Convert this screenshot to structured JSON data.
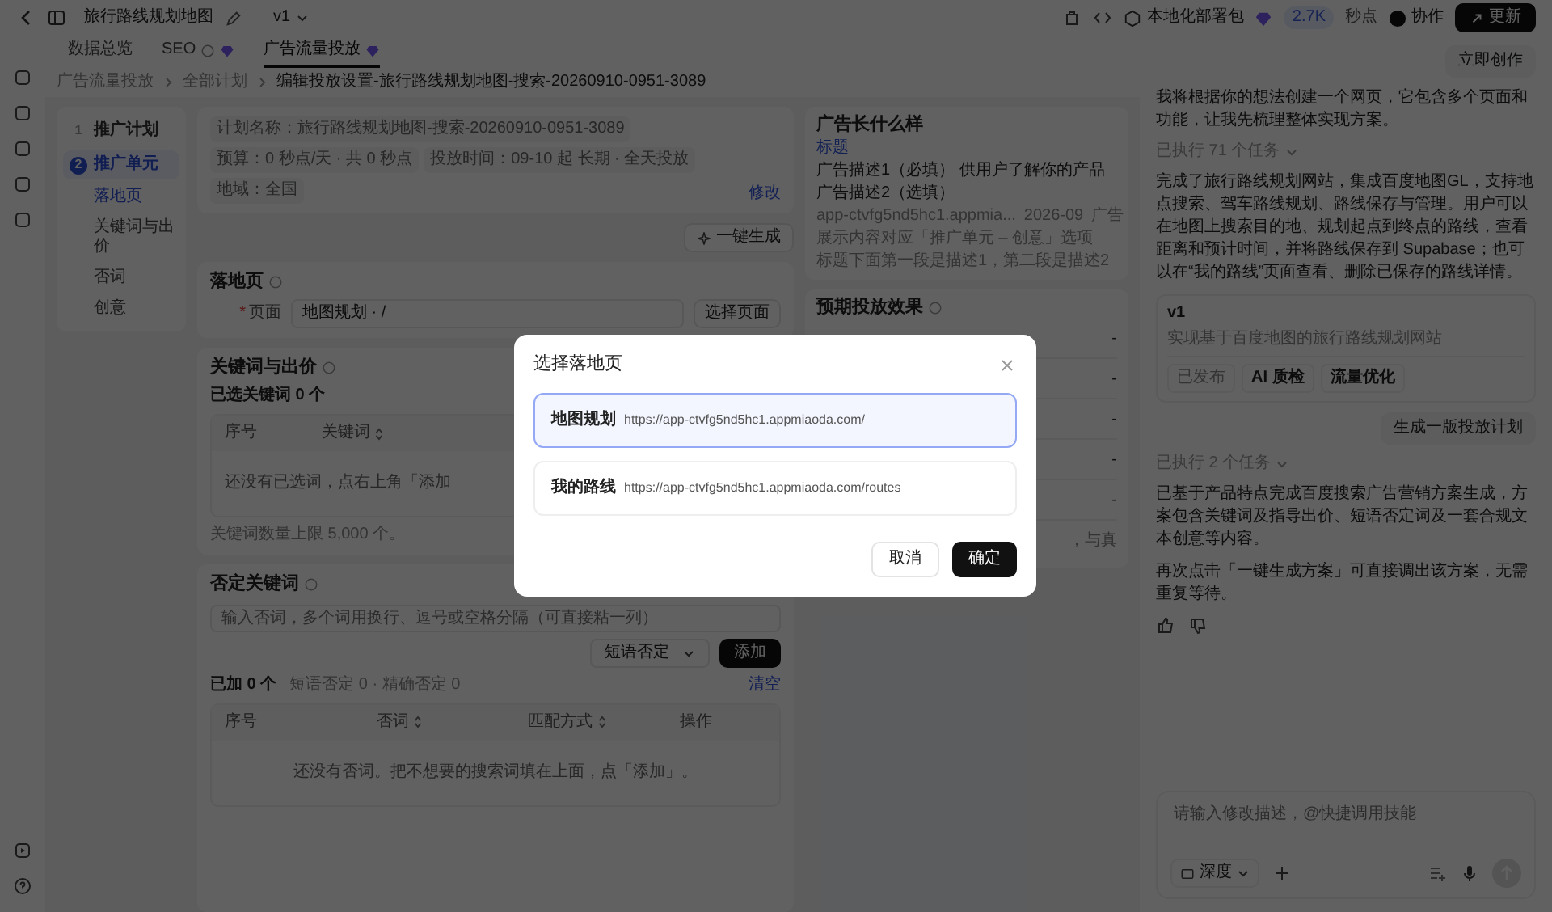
{
  "top_bar": {
    "title": "旅行路线规划地图",
    "version": "v1",
    "deploy": "本地化部署包",
    "points_value": "2.7K",
    "points_unit": "秒点",
    "collab": "协作",
    "update": "更新"
  },
  "tabs": [
    {
      "label": "数据总览",
      "selected": false,
      "help": false,
      "premium": false
    },
    {
      "label": "SEO",
      "selected": false,
      "help": true,
      "premium": true
    },
    {
      "label": "广告流量投放",
      "selected": true,
      "help": false,
      "premium": true
    }
  ],
  "breadcrumb": [
    "广告流量投放",
    "全部计划",
    "编辑投放设置-旅行路线规划地图-搜索-20260910-0951-3089"
  ],
  "steps": [
    {
      "number": "1",
      "label": "推广计划",
      "selected": false
    },
    {
      "number": "2",
      "label": "推广单元",
      "selected": true,
      "children": [
        {
          "label": "落地页",
          "selected": true
        },
        {
          "label": "关键词与出价",
          "selected": false
        },
        {
          "label": "否词",
          "selected": false
        },
        {
          "label": "创意",
          "selected": false
        }
      ]
    }
  ],
  "plan_summary": {
    "chips": [
      {
        "label": "计划名称：",
        "value": "旅行路线规划地图-搜索-20260910-0951-3089"
      },
      {
        "label": "预算：",
        "value": "0 秒点/天 · 共 0 秒点"
      },
      {
        "label": "投放时间：",
        "value": "09-10 起 长期 · 全天投放"
      },
      {
        "label": "地域：",
        "value": "全国"
      }
    ],
    "edit": "修改"
  },
  "generate_button": "一键生成",
  "landing_page": {
    "title": "落地页",
    "required_mark": "*",
    "field_label": "页面",
    "value": "地图规划 · /",
    "button": "选择页面"
  },
  "keywords": {
    "title": "关键词与出价",
    "selected_count": "已选关键词 0 个",
    "columns": [
      {
        "label": "序号",
        "sortable": false
      },
      {
        "label": "关键词",
        "sortable": true
      }
    ],
    "empty": "还没有已选词，点右上角「添加",
    "limit_note": "关键词数量上限 5,000 个。"
  },
  "negative_keywords": {
    "title": "否定关键词",
    "placeholder": "输入否词，多个词用换行、逗号或空格分隔（可直接粘一列）",
    "match_type": "短语否定",
    "add": "添加",
    "added": "已加 0 个",
    "stats": "短语否定 0 · 精确否定 0",
    "clear": "清空",
    "columns": [
      {
        "label": "序号",
        "sortable": false
      },
      {
        "label": "否词",
        "sortable": true
      },
      {
        "label": "匹配方式",
        "sortable": true
      },
      {
        "label": "操作",
        "sortable": false
      }
    ],
    "empty": "还没有否词。把不想要的搜索词填在上面，点「添加」。"
  },
  "ad_preview": {
    "title": "广告长什么样",
    "headline": "标题",
    "descriptions": [
      "广告描述1（必填） 供用户了解你的产品",
      "广告描述2（选填）"
    ],
    "url": "app-ctvfg5nd5hc1.appmia...",
    "date": "2026-09",
    "tag": "广告",
    "notes": [
      "展示内容对应「推广单元 – 创意」选项",
      "标题下面第一段是描述1，第二段是描述2"
    ]
  },
  "forecast": {
    "title": "预期投放效果",
    "rows": [
      "-",
      "-",
      "-",
      "-",
      "-"
    ],
    "note": "，与真"
  },
  "chat": {
    "create_button": "立即创作",
    "intro": "我将根据你的想法创建一个网页，它包含多个页面和功能，让我先梳理整体实现方案。",
    "tasks_1": "已执行 71 个任务",
    "summary": "完成了旅行路线规划网站，集成百度地图GL，支持地点搜索、驾车路线规划、路线保存与管理。用户可以在地图上搜索目的地、规划起点到终点的路线，查看距离和预计时间，并将路线保存到 Supabase；也可以在“我的路线”页面查看、删除已保存的路线详情。",
    "version_card": {
      "name": "v1",
      "description": "实现基于百度地图的旅行路线规划网站",
      "tags": [
        {
          "label": "已发布",
          "disabled": true
        },
        {
          "label": "AI 质检",
          "disabled": false
        },
        {
          "label": "流量优化",
          "disabled": false
        }
      ]
    },
    "user_message": "生成一版投放计划",
    "tasks_2": "已执行 2 个任务",
    "replies": [
      "已基于产品特点完成百度搜索广告营销方案生成，方案包含关键词及指导出价、短语否定词及一套合规文本创意等内容。",
      "再次点击「一键生成方案」可直接调出该方案，无需重复等待。"
    ],
    "input_placeholder": "请输入修改描述，@快捷调用技能",
    "mode": "深度"
  },
  "modal": {
    "title": "选择落地页",
    "options": [
      {
        "name": "地图规划",
        "url": "https://app-ctvfg5nd5hc1.appmiaoda.com/",
        "selected": true
      },
      {
        "name": "我的路线",
        "url": "https://app-ctvfg5nd5hc1.appmiaoda.com/routes",
        "selected": false
      }
    ],
    "cancel": "取消",
    "confirm": "确定"
  }
}
